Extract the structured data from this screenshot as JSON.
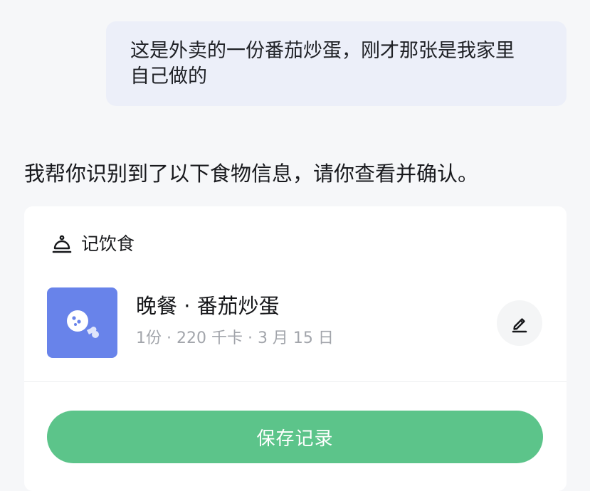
{
  "user_message": {
    "line1": "这是外卖的一份番茄炒蛋，刚才那张是我家里",
    "line2": "自己做的"
  },
  "assistant_message": "我帮你识别到了以下食物信息，请你查看并确认。",
  "meal_card": {
    "icon": "meal-cloche-icon",
    "title": "记饮食",
    "food": {
      "thumbnail_icon": "food-placeholder-icon",
      "name": "晚餐 · 番茄炒蛋",
      "meta": "1份 · 220 千卡 · 3 月 15 日"
    },
    "edit_icon": "pencil-icon",
    "save_label": "保存记录"
  },
  "colors": {
    "page_background": "#f6f7f9",
    "user_bubble": "#eceff9",
    "thumbnail": "#6883ea",
    "save_button": "#5cc48a",
    "meta_text": "#a2a5ab"
  }
}
